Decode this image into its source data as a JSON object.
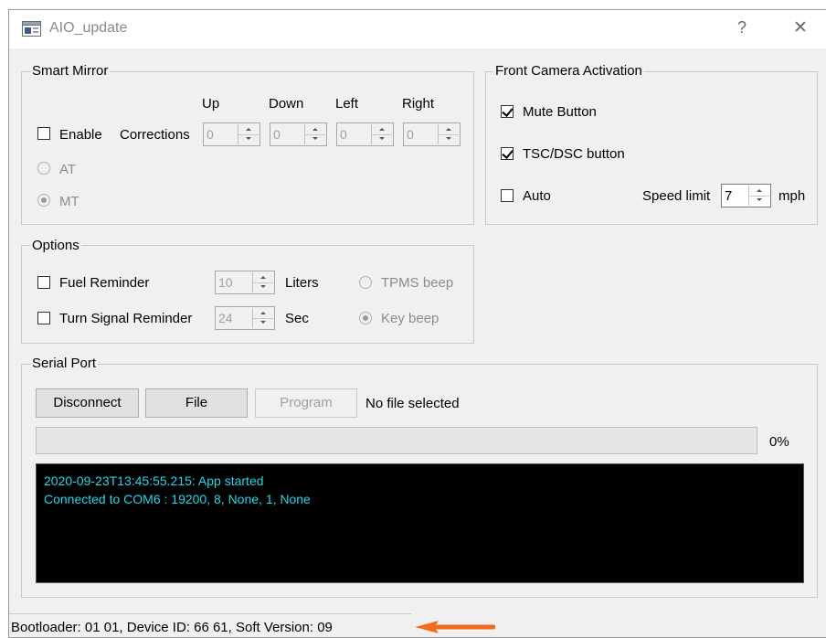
{
  "window": {
    "title": "AIO_update",
    "help_glyph": "?",
    "close_glyph": "✕"
  },
  "smart_mirror": {
    "legend": "Smart Mirror",
    "enable_label": "Enable",
    "corrections_label": "Corrections",
    "directions": [
      {
        "label": "Up",
        "value": "0"
      },
      {
        "label": "Down",
        "value": "0"
      },
      {
        "label": "Left",
        "value": "0"
      },
      {
        "label": "Right",
        "value": "0"
      }
    ],
    "radio_at": "AT",
    "radio_mt": "MT"
  },
  "front_camera": {
    "legend": "Front Camera Activation",
    "mute_label": "Mute Button",
    "tsc_label": "TSC/DSC button",
    "auto_label": "Auto",
    "speed_limit_label": "Speed limit",
    "speed_value": "7",
    "unit": "mph"
  },
  "options": {
    "legend": "Options",
    "fuel_label": "Fuel Reminder",
    "fuel_value": "10",
    "fuel_unit": "Liters",
    "turn_label": "Turn Signal Reminder",
    "turn_value": "24",
    "turn_unit": "Sec",
    "tpms_label": "TPMS beep",
    "key_label": "Key beep"
  },
  "serial_port": {
    "legend": "Serial Port",
    "disconnect_label": "Disconnect",
    "file_label": "File",
    "program_label": "Program",
    "file_status": "No file selected",
    "progress_percent": "0%",
    "progress_value": 0,
    "log": [
      "2020-09-23T13:45:55.215: App started",
      "Connected to COM6 : 19200, 8, None, 1, None"
    ]
  },
  "statusbar": {
    "text": "Bootloader:  01 01, Device ID:  66 61, Soft Version:  09"
  },
  "colors": {
    "window_bg": "#f0f0f0",
    "console_bg": "#000000",
    "console_text": "#22d7e6",
    "arrow": "#f26b1d"
  },
  "icons": {
    "app": "app-window-icon",
    "arrow": "arrow-left-annotation-icon"
  }
}
